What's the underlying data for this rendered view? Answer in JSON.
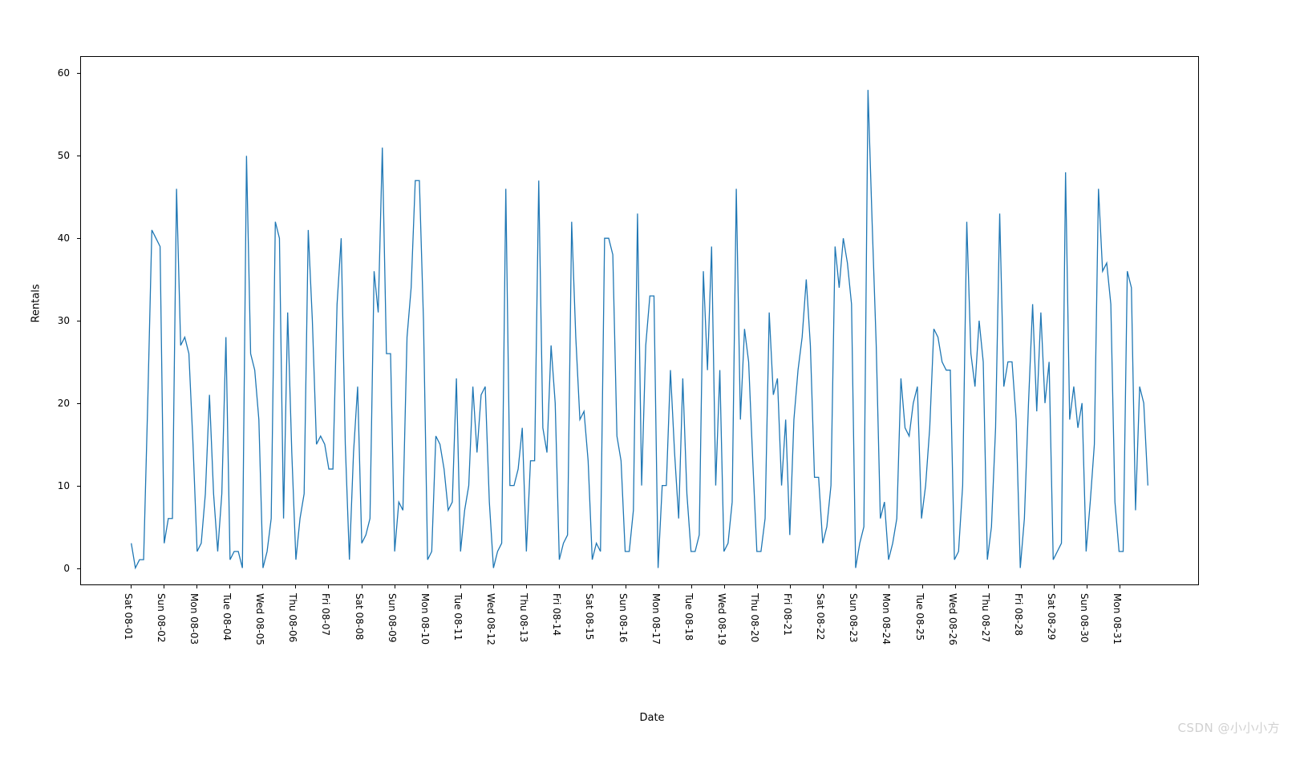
{
  "chart_data": {
    "type": "line",
    "xlabel": "Date",
    "ylabel": "Rentals",
    "ylim": [
      -2,
      62
    ],
    "y_ticks": [
      0,
      10,
      20,
      30,
      40,
      50,
      60
    ],
    "x_tick_labels": [
      "Sat 08-01",
      "Sun 08-02",
      "Mon 08-03",
      "Tue 08-04",
      "Wed 08-05",
      "Thu 08-06",
      "Fri 08-07",
      "Sat 08-08",
      "Sun 08-09",
      "Mon 08-10",
      "Tue 08-11",
      "Wed 08-12",
      "Thu 08-13",
      "Fri 08-14",
      "Sat 08-15",
      "Sun 08-16",
      "Mon 08-17",
      "Tue 08-18",
      "Wed 08-19",
      "Thu 08-20",
      "Fri 08-21",
      "Sat 08-22",
      "Sun 08-23",
      "Mon 08-24",
      "Tue 08-25",
      "Wed 08-26",
      "Thu 08-27",
      "Fri 08-28",
      "Sat 08-29",
      "Sun 08-30",
      "Mon 08-31"
    ],
    "line_color": "#1f77b4",
    "values": [
      3,
      0,
      1,
      1,
      20,
      41,
      40,
      39,
      3,
      6,
      6,
      46,
      27,
      28,
      26,
      15,
      2,
      3,
      9,
      21,
      9,
      2,
      9,
      28,
      1,
      2,
      2,
      0,
      50,
      26,
      24,
      18,
      0,
      2,
      6,
      42,
      40,
      6,
      31,
      14,
      1,
      6,
      9,
      41,
      30,
      15,
      16,
      15,
      12,
      12,
      32,
      40,
      15,
      1,
      14,
      22,
      3,
      4,
      6,
      36,
      31,
      51,
      26,
      26,
      2,
      8,
      7,
      28,
      34,
      47,
      47,
      30,
      1,
      2,
      16,
      15,
      12,
      7,
      8,
      23,
      2,
      7,
      10,
      22,
      14,
      21,
      22,
      8,
      0,
      2,
      3,
      46,
      10,
      10,
      12,
      17,
      2,
      13,
      13,
      47,
      17,
      14,
      27,
      20,
      1,
      3,
      4,
      42,
      28,
      18,
      19,
      13,
      1,
      3,
      2,
      40,
      40,
      38,
      16,
      13,
      2,
      2,
      7,
      43,
      10,
      27,
      33,
      33,
      0,
      10,
      10,
      24,
      14,
      6,
      23,
      9,
      2,
      2,
      4,
      36,
      24,
      39,
      10,
      24,
      2,
      3,
      8,
      46,
      18,
      29,
      25,
      13,
      2,
      2,
      6,
      31,
      21,
      23,
      10,
      18,
      4,
      18,
      24,
      28,
      35,
      27,
      11,
      11,
      3,
      5,
      10,
      39,
      34,
      40,
      37,
      32,
      0,
      3,
      5,
      58,
      42,
      27,
      6,
      8,
      1,
      3,
      6,
      23,
      17,
      16,
      20,
      22,
      6,
      10,
      17,
      29,
      28,
      25,
      24,
      24,
      1,
      2,
      10,
      42,
      26,
      22,
      30,
      25,
      1,
      5,
      17,
      43,
      22,
      25,
      25,
      18,
      0,
      6,
      20,
      32,
      19,
      31,
      20,
      25,
      1,
      2,
      3,
      48,
      18,
      22,
      17,
      20,
      2,
      8,
      15,
      46,
      36,
      37,
      32,
      8,
      2,
      2,
      36,
      34,
      7,
      22,
      20,
      10
    ]
  },
  "watermark": "CSDN @小小小方"
}
